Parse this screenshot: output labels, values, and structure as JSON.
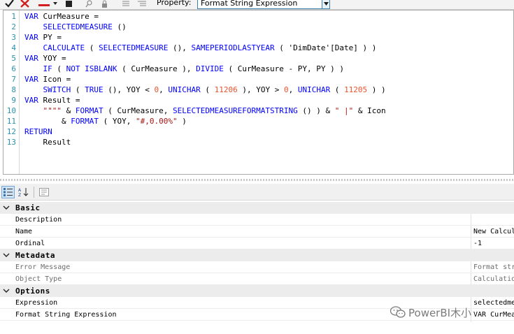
{
  "toolbar": {
    "property_label": "Property:",
    "property_value": "Format String Expression",
    "icons": [
      "check-icon",
      "cancel-x-icon",
      "dropdown-icon",
      "stop-icon",
      "search-icon",
      "lock-icon",
      "align-icon",
      "align-icon-2"
    ]
  },
  "editor": {
    "line_numbers": [
      "1",
      "2",
      "3",
      "4",
      "5",
      "6",
      "7",
      "8",
      "9",
      "10",
      "11",
      "12",
      "13"
    ],
    "lines": [
      [
        {
          "t": "VAR ",
          "c": "kw"
        },
        {
          "t": "CurMeasure =",
          "c": "op"
        }
      ],
      [
        {
          "t": "    ",
          "c": "op"
        },
        {
          "t": "SELECTEDMEASURE",
          "c": "fn"
        },
        {
          "t": " ()",
          "c": "op"
        }
      ],
      [
        {
          "t": "VAR ",
          "c": "kw"
        },
        {
          "t": "PY =",
          "c": "op"
        }
      ],
      [
        {
          "t": "    ",
          "c": "op"
        },
        {
          "t": "CALCULATE",
          "c": "fn"
        },
        {
          "t": " ( ",
          "c": "op"
        },
        {
          "t": "SELECTEDMEASURE",
          "c": "fn"
        },
        {
          "t": " (), ",
          "c": "op"
        },
        {
          "t": "SAMEPERIODLASTYEAR",
          "c": "fn"
        },
        {
          "t": " ( 'DimDate'[Date] ) )",
          "c": "op"
        }
      ],
      [
        {
          "t": "VAR ",
          "c": "kw"
        },
        {
          "t": "YOY =",
          "c": "op"
        }
      ],
      [
        {
          "t": "    ",
          "c": "op"
        },
        {
          "t": "IF",
          "c": "fn"
        },
        {
          "t": " ( ",
          "c": "op"
        },
        {
          "t": "NOT ISBLANK",
          "c": "fn"
        },
        {
          "t": " ( CurMeasure ), ",
          "c": "op"
        },
        {
          "t": "DIVIDE",
          "c": "fn"
        },
        {
          "t": " ( CurMeasure - PY, PY ) )",
          "c": "op"
        }
      ],
      [
        {
          "t": "VAR ",
          "c": "kw"
        },
        {
          "t": "Icon =",
          "c": "op"
        }
      ],
      [
        {
          "t": "    ",
          "c": "op"
        },
        {
          "t": "SWITCH",
          "c": "fn"
        },
        {
          "t": " ( ",
          "c": "op"
        },
        {
          "t": "TRUE",
          "c": "fn"
        },
        {
          "t": " (), YOY < ",
          "c": "op"
        },
        {
          "t": "0",
          "c": "num"
        },
        {
          "t": ", ",
          "c": "op"
        },
        {
          "t": "UNICHAR",
          "c": "fn"
        },
        {
          "t": " ( ",
          "c": "op"
        },
        {
          "t": "11206",
          "c": "num"
        },
        {
          "t": " ), YOY > ",
          "c": "op"
        },
        {
          "t": "0",
          "c": "num"
        },
        {
          "t": ", ",
          "c": "op"
        },
        {
          "t": "UNICHAR",
          "c": "fn"
        },
        {
          "t": " ( ",
          "c": "op"
        },
        {
          "t": "11205",
          "c": "num"
        },
        {
          "t": " ) )",
          "c": "op"
        }
      ],
      [
        {
          "t": "VAR ",
          "c": "kw"
        },
        {
          "t": "Result =",
          "c": "op"
        }
      ],
      [
        {
          "t": "    ",
          "c": "op"
        },
        {
          "t": "\"\"\"\"",
          "c": "str"
        },
        {
          "t": " & ",
          "c": "op"
        },
        {
          "t": "FORMAT",
          "c": "fn"
        },
        {
          "t": " ( CurMeasure, ",
          "c": "op"
        },
        {
          "t": "SELECTEDMEASUREFORMATSTRING",
          "c": "fn"
        },
        {
          "t": " () ) & ",
          "c": "op"
        },
        {
          "t": "\" |\"",
          "c": "str"
        },
        {
          "t": " & Icon",
          "c": "op"
        }
      ],
      [
        {
          "t": "        & ",
          "c": "op"
        },
        {
          "t": "FORMAT",
          "c": "fn"
        },
        {
          "t": " ( YOY, ",
          "c": "op"
        },
        {
          "t": "\"#,0.00%\"",
          "c": "str"
        },
        {
          "t": " )",
          "c": "op"
        }
      ],
      [
        {
          "t": "RETURN",
          "c": "kw"
        }
      ],
      [
        {
          "t": "    Result",
          "c": "op"
        }
      ]
    ]
  },
  "property_grid": {
    "categories": [
      {
        "label": "Basic",
        "props": [
          {
            "name": "Description",
            "value": "",
            "dim": false
          },
          {
            "name": "Name",
            "value": "New Calcul",
            "dim": false
          },
          {
            "name": "Ordinal",
            "value": "-1",
            "dim": false
          }
        ]
      },
      {
        "label": "Metadata",
        "props": [
          {
            "name": "Error Message",
            "value": "Format str",
            "dim": true
          },
          {
            "name": "Object Type",
            "value": "Calculatio",
            "dim": true
          }
        ]
      },
      {
        "label": "Options",
        "props": [
          {
            "name": "Expression",
            "value": "selectedme",
            "dim": false
          },
          {
            "name": "Format String Expression",
            "value": "VAR CurMeas",
            "dim": false
          }
        ]
      }
    ]
  },
  "watermark": {
    "text": "PowerBI木小"
  }
}
